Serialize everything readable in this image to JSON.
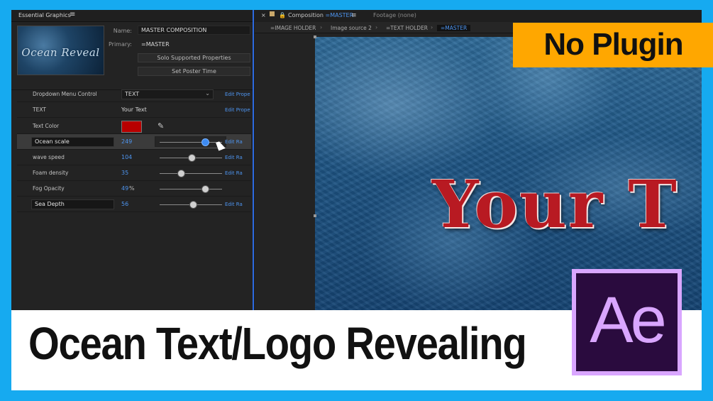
{
  "essential_graphics": {
    "title": "Essential Graphics",
    "menu_icon": "hamburger-icon",
    "thumbnail_text": "Ocean Reveal",
    "name_label": "Name:",
    "name_value": "MASTER COMPOSITION",
    "primary_label": "Primary:",
    "primary_value": "=MASTER",
    "solo_button": "Solo Supported Properties",
    "poster_button": "Set Poster Time",
    "rows": [
      {
        "label": "Dropdown Menu Control",
        "value": "TEXT",
        "link": "Edit Prope"
      },
      {
        "label": "TEXT",
        "value": "Your Text",
        "link": "Edit Prope"
      },
      {
        "label": "Text Color",
        "color": "#b80000"
      },
      {
        "label": "Ocean scale",
        "value": "249",
        "link": "Edit Ra",
        "slider": 0.74
      },
      {
        "label": "wave speed",
        "value": "104",
        "link": "Edit Ra",
        "slider": 0.52
      },
      {
        "label": "Foam density",
        "value": "35",
        "link": "Edit Ra",
        "slider": 0.35
      },
      {
        "label": "Fog Opacity",
        "value": "49",
        "unit": "%",
        "slider": 0.74
      },
      {
        "label": "Sea Depth",
        "value": "56",
        "link": "Edit Ra",
        "slider": 0.55
      }
    ]
  },
  "composition": {
    "close_icon": "close-icon",
    "tab_title": "Composition",
    "tab_comp": "=MASTER",
    "footage_tab": "Footage  (none)",
    "breadcrumbs": [
      "=IMAGE HOLDER",
      "Image source 2",
      "=TEXT HOLDER",
      "=MASTER"
    ],
    "viewer_text": "Your T"
  },
  "overlay": {
    "badge": "No Plugin",
    "badge_color": "#ffa700",
    "headline": "Ocean Text/Logo Revealing",
    "ae_logo": "Ae"
  }
}
